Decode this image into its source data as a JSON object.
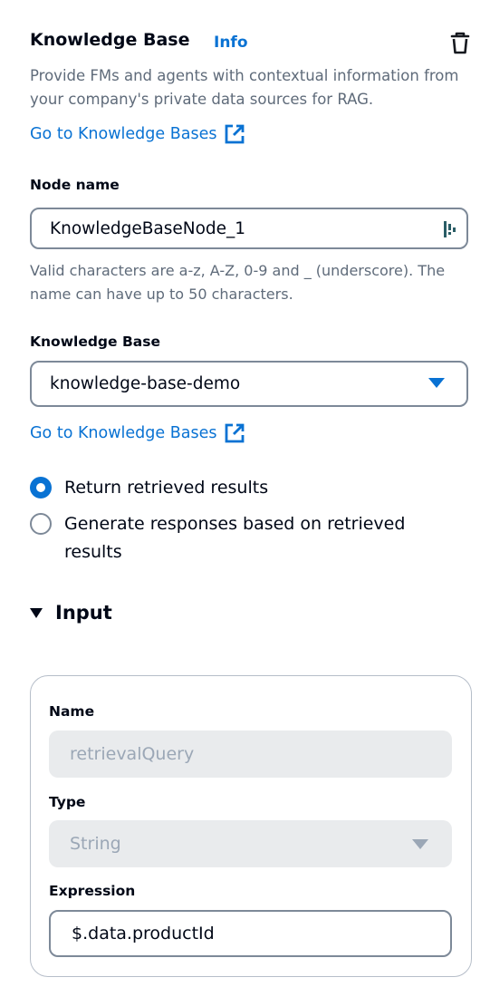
{
  "panel": {
    "title": "Knowledge Base",
    "info_label": "Info",
    "description": "Provide FMs and agents with contextual information from your company's private data sources for RAG.",
    "go_to_kb_link": "Go to Knowledge Bases"
  },
  "node_name": {
    "label": "Node name",
    "value": "KnowledgeBaseNode_1",
    "hint": "Valid characters are a-z, A-Z, 0-9 and _ (underscore). The name can have up to 50 characters."
  },
  "knowledge_base": {
    "label": "Knowledge Base",
    "selected": "knowledge-base-demo",
    "go_to_kb_link": "Go to Knowledge Bases"
  },
  "mode_options": [
    {
      "label": "Return retrieved results",
      "checked": true
    },
    {
      "label": "Generate responses based on retrieved results",
      "checked": false
    }
  ],
  "input_section": {
    "title": "Input",
    "name_label": "Name",
    "name_value": "retrievalQuery",
    "type_label": "Type",
    "type_value": "String",
    "expression_label": "Expression",
    "expression_value": "$.data.productId"
  },
  "colors": {
    "link": "#0972d3",
    "text": "#000716",
    "muted": "#5f6b7a",
    "disabled_bg": "#e9ebed"
  }
}
